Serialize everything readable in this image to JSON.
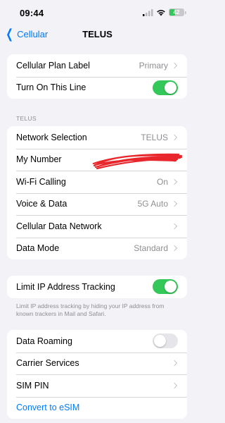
{
  "status_bar": {
    "time": "09:44",
    "battery_level": "42",
    "battery_fraction": 0.42
  },
  "nav": {
    "back_label": "Cellular",
    "title": "TELUS"
  },
  "group1": [
    {
      "label": "Cellular Plan Label",
      "value": "Primary",
      "kind": "chevron"
    },
    {
      "label": "Turn On This Line",
      "kind": "toggle",
      "on": true
    }
  ],
  "section_header": "TELUS",
  "group2": [
    {
      "label": "Network Selection",
      "value": "TELUS",
      "kind": "chevron"
    },
    {
      "label": "My Number",
      "value": "",
      "kind": "chevron",
      "redacted": true
    },
    {
      "label": "Wi-Fi Calling",
      "value": "On",
      "kind": "chevron"
    },
    {
      "label": "Voice & Data",
      "value": "5G Auto",
      "kind": "chevron"
    },
    {
      "label": "Cellular Data Network",
      "value": "",
      "kind": "chevron"
    },
    {
      "label": "Data Mode",
      "value": "Standard",
      "kind": "chevron"
    }
  ],
  "group3": [
    {
      "label": "Limit IP Address Tracking",
      "kind": "toggle",
      "on": true
    }
  ],
  "group3_footer": "Limit IP address tracking by hiding your IP address from known trackers in Mail and Safari.",
  "group4": [
    {
      "label": "Data Roaming",
      "kind": "toggle",
      "on": false
    },
    {
      "label": "Carrier Services",
      "value": "",
      "kind": "chevron"
    },
    {
      "label": "SIM PIN",
      "value": "",
      "kind": "chevron"
    },
    {
      "label": "Convert to eSIM",
      "kind": "link"
    }
  ],
  "colors": {
    "accent": "#007aff",
    "toggle_on": "#34c759",
    "background": "#f2f2f7",
    "redaction": "#e8262b"
  }
}
